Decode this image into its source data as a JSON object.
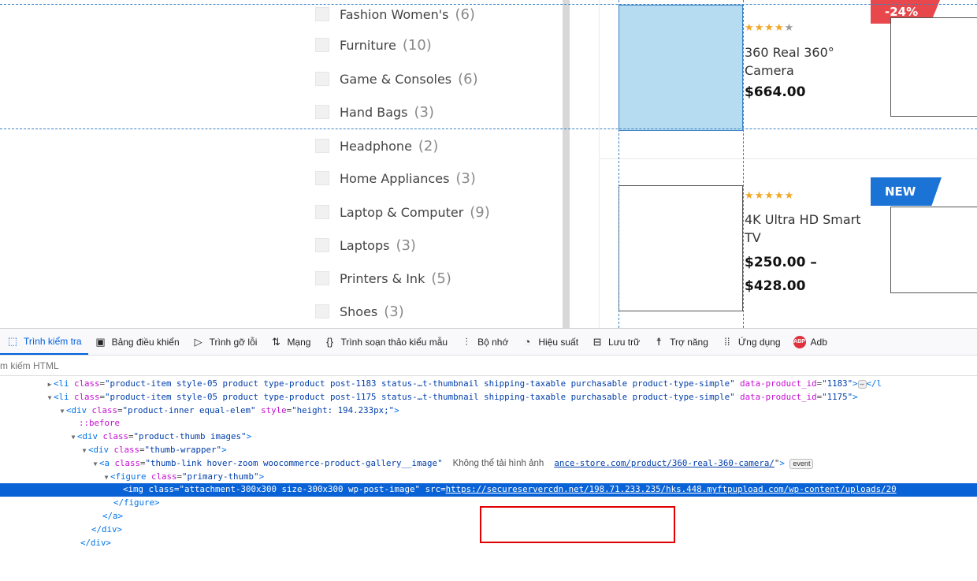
{
  "categories": [
    {
      "name": "Fashion Women's",
      "count": "(6)"
    },
    {
      "name": "Furniture",
      "count": "(10)"
    },
    {
      "name": "Game & Consoles",
      "count": "(6)"
    },
    {
      "name": "Hand Bags",
      "count": "(3)"
    },
    {
      "name": "Headphone",
      "count": "(2)"
    },
    {
      "name": "Home Appliances",
      "count": "(3)"
    },
    {
      "name": "Laptop & Computer",
      "count": "(9)"
    },
    {
      "name": "Laptops",
      "count": "(3)"
    },
    {
      "name": "Printers & Ink",
      "count": "(5)"
    },
    {
      "name": "Shoes",
      "count": "(3)"
    }
  ],
  "products": [
    {
      "rating": 4,
      "name": "360 Real 360° Camera",
      "price_lines": [
        "$664.00"
      ]
    },
    {
      "rating": 5,
      "name": "4K Ultra HD Smart TV",
      "price_lines": [
        "$250.00 –",
        "$428.00"
      ]
    }
  ],
  "badges": {
    "sale": "-24%",
    "new": "NEW"
  },
  "devtools": {
    "tabs": [
      {
        "label": "Trình kiểm tra",
        "icon": "inspector-icon",
        "glyph": "⬚"
      },
      {
        "label": "Bảng điều khiển",
        "icon": "console-icon",
        "glyph": "▣"
      },
      {
        "label": "Trình gỡ lỗi",
        "icon": "debugger-icon",
        "glyph": "▷"
      },
      {
        "label": "Mạng",
        "icon": "network-icon",
        "glyph": "⇅"
      },
      {
        "label": "Trình soạn thảo kiểu mẫu",
        "icon": "style-editor-icon",
        "glyph": "{}"
      },
      {
        "label": "Bộ nhớ",
        "icon": "memory-icon",
        "glyph": "⫶"
      },
      {
        "label": "Hiệu suất",
        "icon": "performance-icon",
        "glyph": "◔"
      },
      {
        "label": "Lưu trữ",
        "icon": "storage-icon",
        "glyph": "⊟"
      },
      {
        "label": "Trợ năng",
        "icon": "accessibility-icon",
        "glyph": "☨"
      },
      {
        "label": "Ứng dụng",
        "icon": "application-icon",
        "glyph": "⁞⁞"
      },
      {
        "label": "Adb",
        "icon": "adblock-icon",
        "glyph": "ABP"
      }
    ],
    "search_placeholder": "m kiếm HTML",
    "lines": {
      "l1_attr1": "class",
      "l1_val1": "\"product-item style-05 product type-product post-1183 status-…t-thumbnail shipping-taxable purchasable product-type-simple\"",
      "l1_attr2": "data-product_id",
      "l1_val2": "\"1183\"",
      "l2_attr1": "class",
      "l2_val1": "\"product-item style-05 product type-product post-1175 status-…t-thumbnail shipping-taxable purchasable product-type-simple\"",
      "l2_attr2": "data-product_id",
      "l2_val2": "\"1175\"",
      "l3_val1": "\"product-inner equal-elem\"",
      "l3_attr2": "style",
      "l3_val2": "\"height: 194.233px;\"",
      "l4_pseudo": "::before",
      "l5_val": "\"product-thumb images\"",
      "l6_val": "\"thumb-wrapper\"",
      "l7_val": "\"thumb-link hover-zoom woocommerce-product-gallery__image\"",
      "l7_note": "Không thể tải hình ảnh",
      "l7_href": "ance-store.com/product/360-real-360-camera/",
      "l7_event": "event",
      "l8_val": "\"primary-thumb\"",
      "l9_val": "\"attachment-300x300 size-300x300 wp-post-image\"",
      "l9_src": "https://secureservercdn.net/198.71.233.235/hks.448.myftpupload.com/wp-content/uploads/20"
    }
  }
}
